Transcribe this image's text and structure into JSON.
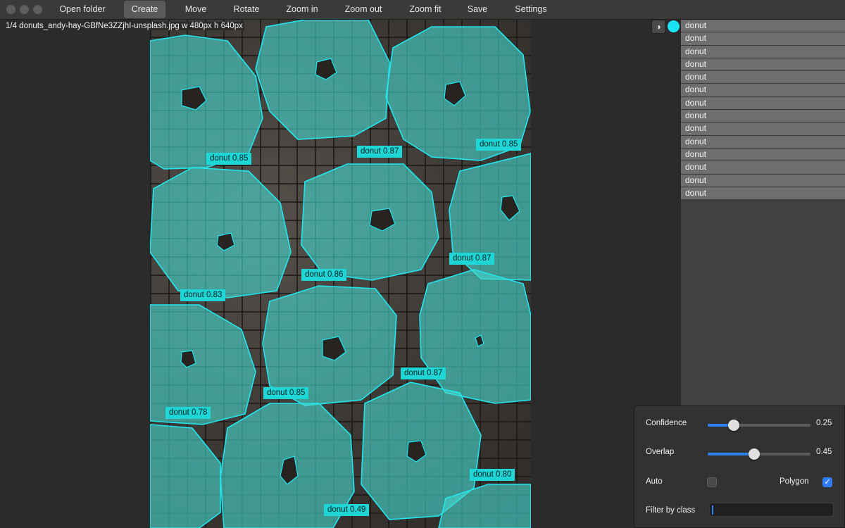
{
  "toolbar": {
    "open_folder": "Open folder",
    "create": "Create",
    "move": "Move",
    "rotate": "Rotate",
    "zoom_in": "Zoom in",
    "zoom_out": "Zoom out",
    "zoom_fit": "Zoom fit",
    "save": "Save",
    "settings": "Settings"
  },
  "file_info": "1/4 donuts_andy-hay-GBfNe3ZZjhI-unsplash.jpg w 480px h 640px",
  "contrast_icon": "◑",
  "accent_color": "#18e4f2",
  "detections": [
    {
      "label": "donut 0.85"
    },
    {
      "label": "donut 0.87"
    },
    {
      "label": "donut 0.85"
    },
    {
      "label": "donut 0.86"
    },
    {
      "label": "donut 0.87"
    },
    {
      "label": "donut 0.83"
    },
    {
      "label": "donut 0.87"
    },
    {
      "label": "donut 0.85"
    },
    {
      "label": "donut 0.78"
    },
    {
      "label": "donut 0.80"
    },
    {
      "label": "donut 0.49"
    }
  ],
  "class_list": [
    "donut",
    "donut",
    "donut",
    "donut",
    "donut",
    "donut",
    "donut",
    "donut",
    "donut",
    "donut",
    "donut",
    "donut",
    "donut",
    "donut"
  ],
  "settings": {
    "confidence_label": "Confidence",
    "confidence_value": "0.25",
    "confidence": 0.25,
    "overlap_label": "Overlap",
    "overlap_value": "0.45",
    "overlap": 0.45,
    "auto_label": "Auto",
    "auto_checked": false,
    "polygon_label": "Polygon",
    "polygon_checked": true,
    "filter_label": "Filter by class",
    "filter_value": ""
  }
}
